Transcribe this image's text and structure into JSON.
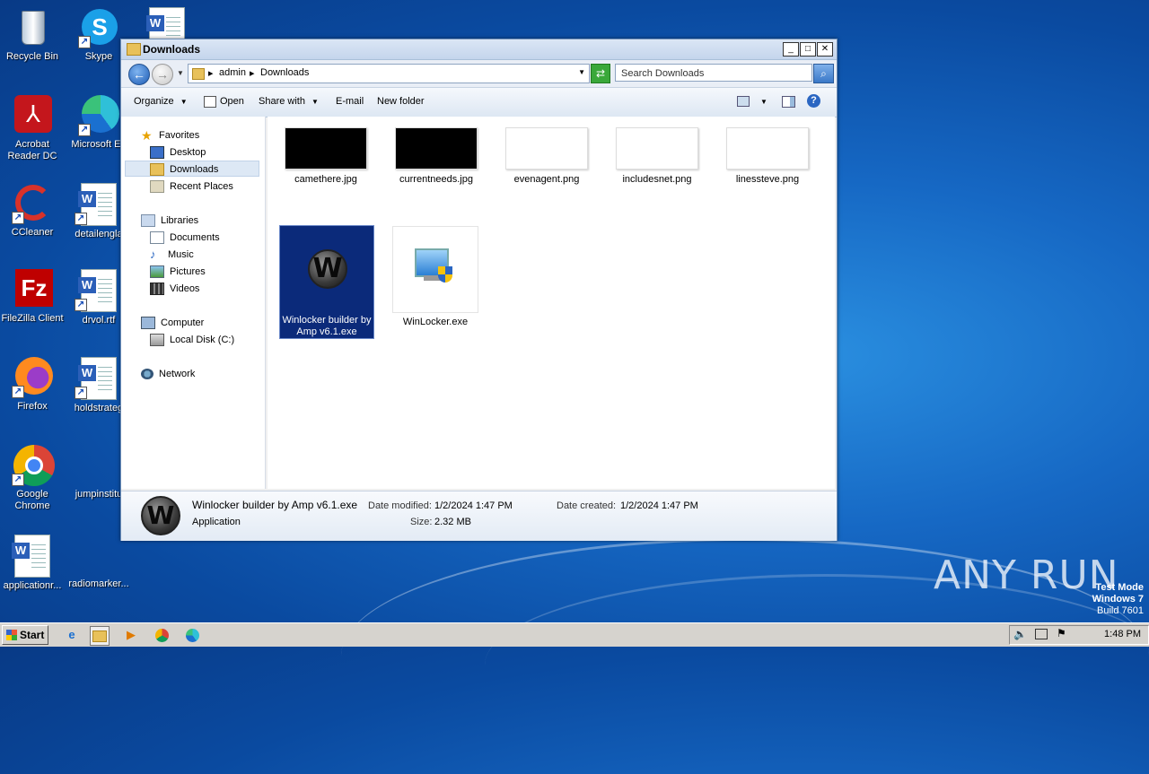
{
  "desktop": {
    "icons": [
      {
        "label": "Recycle Bin"
      },
      {
        "label": "Skype"
      },
      {
        "label": "Acrobat\nReader DC"
      },
      {
        "label": "Microsoft Ed"
      },
      {
        "label": "CCleaner"
      },
      {
        "label": "detailengla"
      },
      {
        "label": "FileZilla Client"
      },
      {
        "label": "drvol.rtf"
      },
      {
        "label": "Firefox"
      },
      {
        "label": "holdstrateg"
      },
      {
        "label": "Google\nChrome"
      },
      {
        "label": "jumpinstitu"
      },
      {
        "label": "applicationr..."
      },
      {
        "label": "radiomarker..."
      }
    ]
  },
  "window": {
    "title": "Downloads",
    "buttons": {
      "minimize": "_",
      "maximize": "□",
      "close": "✕"
    },
    "breadcrumb": [
      "admin",
      "Downloads"
    ],
    "search_placeholder": "Search Downloads",
    "toolbar": {
      "organize": "Organize",
      "open": "Open",
      "share_with": "Share with",
      "email": "E-mail",
      "new_folder": "New folder"
    },
    "nav": {
      "favorites": "Favorites",
      "desktop": "Desktop",
      "downloads": "Downloads",
      "recent": "Recent Places",
      "libraries": "Libraries",
      "documents": "Documents",
      "music": "Music",
      "pictures": "Pictures",
      "videos": "Videos",
      "computer": "Computer",
      "local_disk": "Local Disk (C:)",
      "network": "Network"
    },
    "files": [
      {
        "name": "camethere.jpg"
      },
      {
        "name": "currentneeds.jpg"
      },
      {
        "name": "evenagent.png"
      },
      {
        "name": "includesnet.png"
      },
      {
        "name": "linessteve.png"
      },
      {
        "name": "Winlocker builder by Amp v6.1.exe"
      },
      {
        "name": "WinLocker.exe"
      }
    ],
    "details": {
      "name": "Winlocker builder by Amp v6.1.exe",
      "type": "Application",
      "modified_label": "Date modified:",
      "modified": "1/2/2024 1:47 PM",
      "created_label": "Date created:",
      "created": "1/2/2024 1:47 PM",
      "size_label": "Size:",
      "size": "2.32 MB"
    }
  },
  "taskbar": {
    "start": "Start",
    "clock": "1:48 PM"
  },
  "watermark": {
    "line1": "Test Mode",
    "line2": "Windows 7",
    "line3": "Build 7601",
    "brand": "ANY RUN"
  },
  "colors": {
    "selection": "#0b2a7a",
    "desktop": "#1668c4"
  }
}
